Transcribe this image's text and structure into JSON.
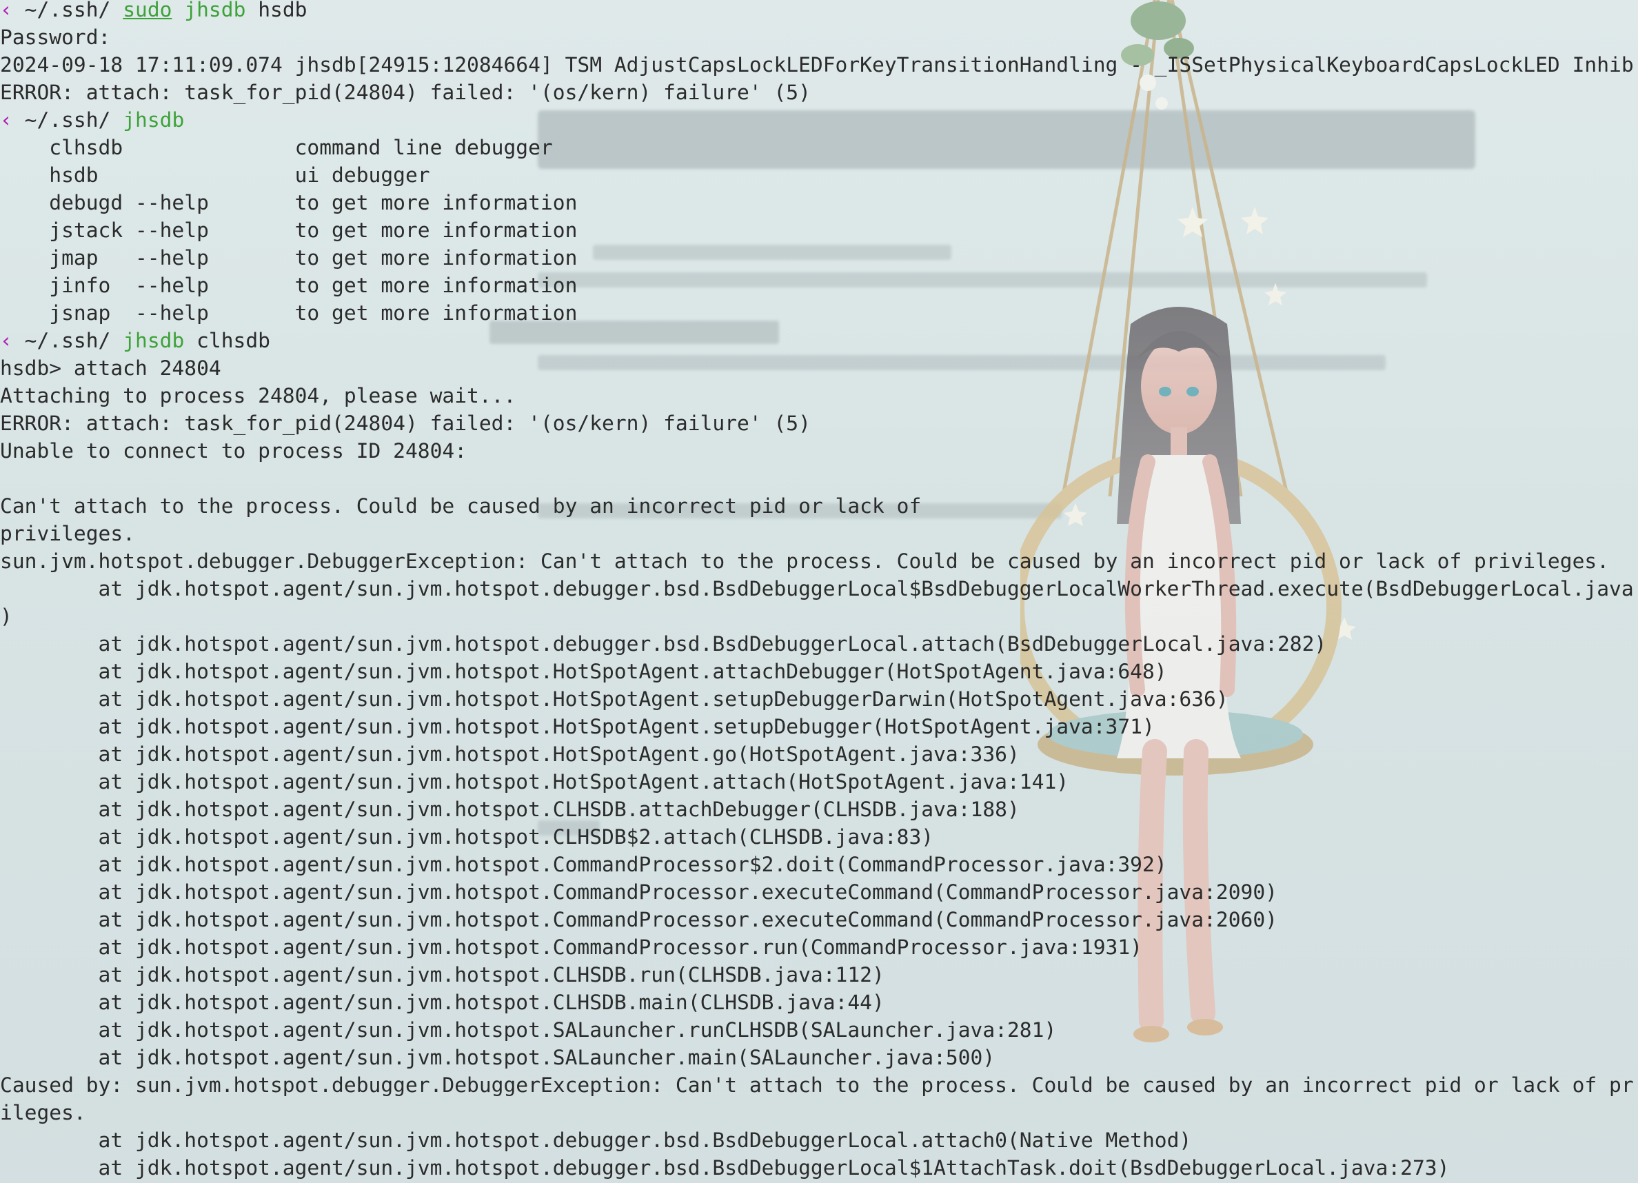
{
  "terminal": {
    "prompt": {
      "glyph": "‹",
      "path": "~/.ssh/"
    },
    "colors": {
      "text": "#2b2b2b",
      "prompt_glyph": "#b01db5",
      "command": "#3ea23a",
      "background": "#dfe9ea"
    },
    "lines": [
      {
        "kind": "prompt",
        "segments": [
          {
            "t": "‹",
            "s": "glyph"
          },
          {
            "t": " ~/.ssh/ ",
            "s": "plain"
          },
          {
            "t": "sudo",
            "s": "underline"
          },
          {
            "t": " ",
            "s": "plain"
          },
          {
            "t": "jhsdb",
            "s": "green"
          },
          {
            "t": " hsdb",
            "s": "plain"
          }
        ]
      },
      {
        "kind": "out",
        "text": "Password:"
      },
      {
        "kind": "out",
        "text": "2024-09-18 17:11:09.074 jhsdb[24915:12084664] TSM AdjustCapsLockLEDForKeyTransitionHandling - _ISSetPhysicalKeyboardCapsLockLED Inhib"
      },
      {
        "kind": "out",
        "text": "ERROR: attach: task_for_pid(24804) failed: '(os/kern) failure' (5)"
      },
      {
        "kind": "prompt",
        "segments": [
          {
            "t": "‹",
            "s": "glyph"
          },
          {
            "t": " ~/.ssh/ ",
            "s": "plain"
          },
          {
            "t": "jhsdb",
            "s": "green"
          }
        ]
      },
      {
        "kind": "out",
        "text": "    clhsdb              command line debugger"
      },
      {
        "kind": "out",
        "text": "    hsdb                ui debugger"
      },
      {
        "kind": "out",
        "text": "    debugd --help       to get more information"
      },
      {
        "kind": "out",
        "text": "    jstack --help       to get more information"
      },
      {
        "kind": "out",
        "text": "    jmap   --help       to get more information"
      },
      {
        "kind": "out",
        "text": "    jinfo  --help       to get more information"
      },
      {
        "kind": "out",
        "text": "    jsnap  --help       to get more information"
      },
      {
        "kind": "prompt",
        "segments": [
          {
            "t": "‹",
            "s": "glyph"
          },
          {
            "t": " ~/.ssh/ ",
            "s": "plain"
          },
          {
            "t": "jhsdb",
            "s": "green"
          },
          {
            "t": " clhsdb",
            "s": "plain"
          }
        ]
      },
      {
        "kind": "out",
        "text": "hsdb> attach 24804"
      },
      {
        "kind": "out",
        "text": "Attaching to process 24804, please wait..."
      },
      {
        "kind": "out",
        "text": "ERROR: attach: task_for_pid(24804) failed: '(os/kern) failure' (5)"
      },
      {
        "kind": "out",
        "text": "Unable to connect to process ID 24804:"
      },
      {
        "kind": "out",
        "text": ""
      },
      {
        "kind": "out",
        "text": "Can't attach to the process. Could be caused by an incorrect pid or lack of"
      },
      {
        "kind": "out",
        "text": "privileges."
      },
      {
        "kind": "out",
        "text": "sun.jvm.hotspot.debugger.DebuggerException: Can't attach to the process. Could be caused by an incorrect pid or lack of privileges."
      },
      {
        "kind": "out",
        "text": "        at jdk.hotspot.agent/sun.jvm.hotspot.debugger.bsd.BsdDebuggerLocal$BsdDebuggerLocalWorkerThread.execute(BsdDebuggerLocal.java"
      },
      {
        "kind": "out",
        "text": ")"
      },
      {
        "kind": "out",
        "text": "        at jdk.hotspot.agent/sun.jvm.hotspot.debugger.bsd.BsdDebuggerLocal.attach(BsdDebuggerLocal.java:282)"
      },
      {
        "kind": "out",
        "text": "        at jdk.hotspot.agent/sun.jvm.hotspot.HotSpotAgent.attachDebugger(HotSpotAgent.java:648)"
      },
      {
        "kind": "out",
        "text": "        at jdk.hotspot.agent/sun.jvm.hotspot.HotSpotAgent.setupDebuggerDarwin(HotSpotAgent.java:636)"
      },
      {
        "kind": "out",
        "text": "        at jdk.hotspot.agent/sun.jvm.hotspot.HotSpotAgent.setupDebugger(HotSpotAgent.java:371)"
      },
      {
        "kind": "out",
        "text": "        at jdk.hotspot.agent/sun.jvm.hotspot.HotSpotAgent.go(HotSpotAgent.java:336)"
      },
      {
        "kind": "out",
        "text": "        at jdk.hotspot.agent/sun.jvm.hotspot.HotSpotAgent.attach(HotSpotAgent.java:141)"
      },
      {
        "kind": "out",
        "text": "        at jdk.hotspot.agent/sun.jvm.hotspot.CLHSDB.attachDebugger(CLHSDB.java:188)"
      },
      {
        "kind": "out",
        "text": "        at jdk.hotspot.agent/sun.jvm.hotspot.CLHSDB$2.attach(CLHSDB.java:83)"
      },
      {
        "kind": "out",
        "text": "        at jdk.hotspot.agent/sun.jvm.hotspot.CommandProcessor$2.doit(CommandProcessor.java:392)"
      },
      {
        "kind": "out",
        "text": "        at jdk.hotspot.agent/sun.jvm.hotspot.CommandProcessor.executeCommand(CommandProcessor.java:2090)"
      },
      {
        "kind": "out",
        "text": "        at jdk.hotspot.agent/sun.jvm.hotspot.CommandProcessor.executeCommand(CommandProcessor.java:2060)"
      },
      {
        "kind": "out",
        "text": "        at jdk.hotspot.agent/sun.jvm.hotspot.CommandProcessor.run(CommandProcessor.java:1931)"
      },
      {
        "kind": "out",
        "text": "        at jdk.hotspot.agent/sun.jvm.hotspot.CLHSDB.run(CLHSDB.java:112)"
      },
      {
        "kind": "out",
        "text": "        at jdk.hotspot.agent/sun.jvm.hotspot.CLHSDB.main(CLHSDB.java:44)"
      },
      {
        "kind": "out",
        "text": "        at jdk.hotspot.agent/sun.jvm.hotspot.SALauncher.runCLHSDB(SALauncher.java:281)"
      },
      {
        "kind": "out",
        "text": "        at jdk.hotspot.agent/sun.jvm.hotspot.SALauncher.main(SALauncher.java:500)"
      },
      {
        "kind": "out",
        "text": "Caused by: sun.jvm.hotspot.debugger.DebuggerException: Can't attach to the process. Could be caused by an incorrect pid or lack of pr"
      },
      {
        "kind": "out",
        "text": "ileges."
      },
      {
        "kind": "out",
        "text": "        at jdk.hotspot.agent/sun.jvm.hotspot.debugger.bsd.BsdDebuggerLocal.attach0(Native Method)"
      },
      {
        "kind": "out",
        "text": "        at jdk.hotspot.agent/sun.jvm.hotspot.debugger.bsd.BsdDebuggerLocal$1AttachTask.doit(BsdDebuggerLocal.java:273)"
      }
    ]
  }
}
